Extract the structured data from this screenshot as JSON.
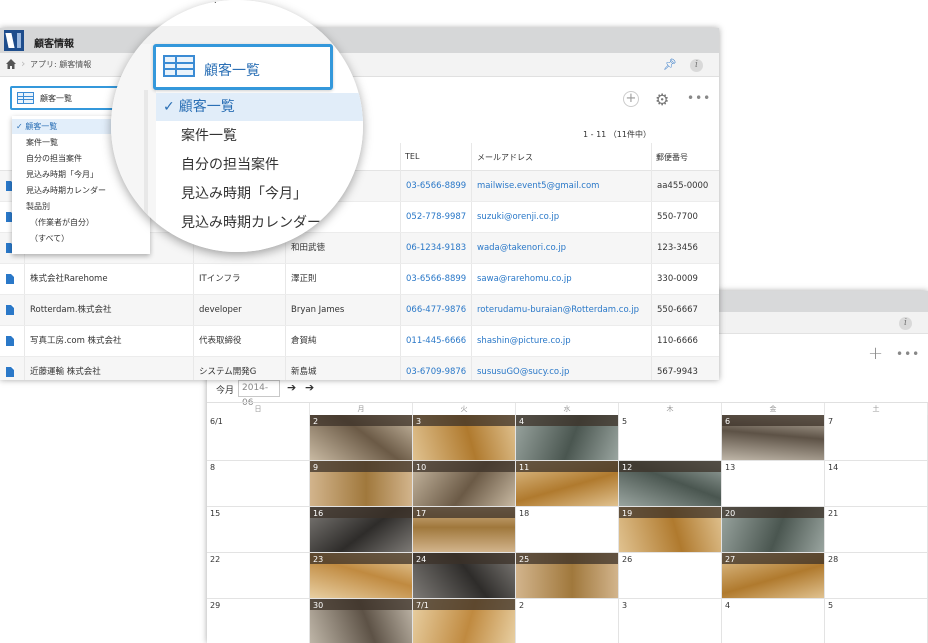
{
  "app": {
    "title": "顧客情報",
    "breadcrumb": "アプリ: 顧客情報"
  },
  "view": {
    "current": "顧客一覧",
    "count_label": "1 - 11 （11件中）",
    "options": [
      "顧客一覧",
      "案件一覧",
      "自分の担当案件",
      "見込み時期「今月」",
      "見込み時期カレンダー",
      "製品別",
      "（作業者が自分）",
      "（すべて）"
    ]
  },
  "lens": {
    "view_label": "顧客一覧",
    "items": [
      "顧客一覧",
      "案件一覧",
      "自分の担当案件",
      "見込み時期「今月」",
      "見込み時期カレンダー"
    ]
  },
  "table": {
    "headers": [
      "TEL",
      "メールアドレス",
      "郵便番号"
    ],
    "rows": [
      {
        "company": "",
        "dept": "",
        "person": "",
        "tel": "03-6566-8899",
        "email": "mailwise.event5@gmail.com",
        "zip": "aa455-0000"
      },
      {
        "company": "",
        "dept": "",
        "person": "",
        "tel": "052-778-9987",
        "email": "suzuki@orenji.co.jp",
        "zip": "550-7700"
      },
      {
        "company": "",
        "dept": "",
        "person": "和田武徳",
        "tel": "06-1234-9183",
        "email": "wada@takenori.co.jp",
        "zip": "123-3456"
      },
      {
        "company": "株式会社Rarehome",
        "dept": "ITインフラ",
        "person": "澤正則",
        "tel": "03-6566-8899",
        "email": "sawa@rarehomu.co.jp",
        "zip": "330-0009"
      },
      {
        "company": "Rotterdam.株式会社",
        "dept": "developer",
        "person": "Bryan James",
        "tel": "066-477-9876",
        "email": "roterudamu-buraian@Rotterdam.co.jp",
        "zip": "550-6667"
      },
      {
        "company": "写真工房.com 株式会社",
        "dept": "代表取締役",
        "person": "倉賀純",
        "tel": "011-445-6666",
        "email": "shashin@picture.co.jp",
        "zip": "110-6666"
      },
      {
        "company": "近藤運輸 株式会社",
        "dept": "システム開発G",
        "person": "新島城",
        "tel": "03-6709-9876",
        "email": "sususuGO@sucy.co.jp",
        "zip": "567-9943"
      }
    ]
  },
  "calendar": {
    "today_label": "今月",
    "month_value": "2014-06",
    "weekdays": [
      "日",
      "月",
      "火",
      "水",
      "木",
      "金",
      "土"
    ],
    "weeks": [
      [
        "6/1",
        "2",
        "3",
        "4",
        "5",
        "6",
        "7"
      ],
      [
        "8",
        "9",
        "10",
        "11",
        "12",
        "13",
        "14"
      ],
      [
        "15",
        "16",
        "17",
        "18",
        "19",
        "20",
        "21"
      ],
      [
        "22",
        "23",
        "24",
        "25",
        "26",
        "27",
        "28"
      ],
      [
        "29",
        "30",
        "7/1",
        "2",
        "3",
        "4",
        "5"
      ]
    ],
    "photo_days": [
      [
        1,
        2,
        3,
        5
      ],
      [
        1,
        2,
        3,
        4
      ],
      [
        1,
        2,
        4,
        5
      ],
      [
        1,
        2,
        3,
        5
      ],
      [
        1,
        2
      ]
    ]
  },
  "colors": {
    "accent": "#3498db",
    "link": "#2a78c8",
    "topbar": "#d6d7d8"
  }
}
